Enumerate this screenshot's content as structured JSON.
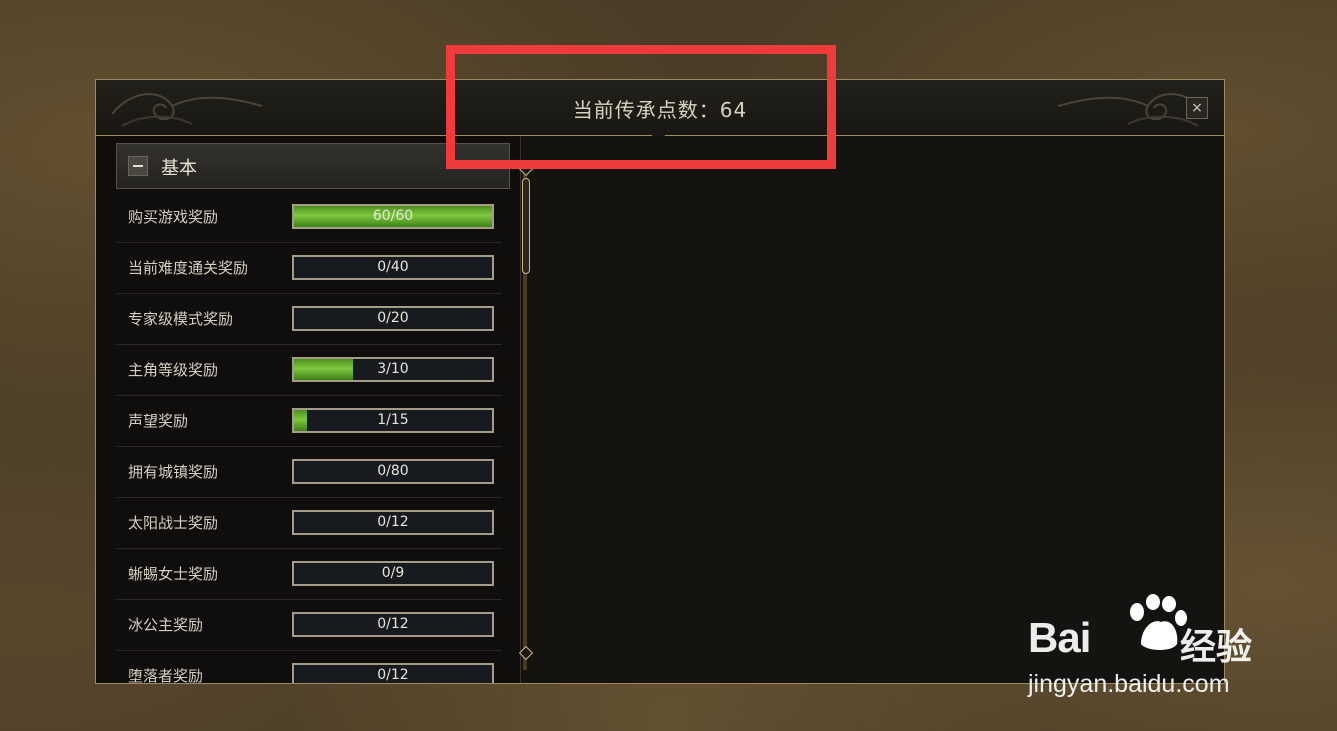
{
  "window": {
    "title": "当前传承点数：64",
    "close_label": "×"
  },
  "section": {
    "title": "基本",
    "rows": [
      {
        "label": "购买游戏奖励",
        "progress": "60/60",
        "fill": 1.0
      },
      {
        "label": "当前难度通关奖励",
        "progress": "0/40",
        "fill": 0.0
      },
      {
        "label": "专家级模式奖励",
        "progress": "0/20",
        "fill": 0.0
      },
      {
        "label": "主角等级奖励",
        "progress": "3/10",
        "fill": 0.3
      },
      {
        "label": "声望奖励",
        "progress": "1/15",
        "fill": 0.067
      },
      {
        "label": "拥有城镇奖励",
        "progress": "0/80",
        "fill": 0.0
      },
      {
        "label": "太阳战士奖励",
        "progress": "0/12",
        "fill": 0.0
      },
      {
        "label": "蜥蜴女士奖励",
        "progress": "0/9",
        "fill": 0.0
      },
      {
        "label": "冰公主奖励",
        "progress": "0/12",
        "fill": 0.0
      },
      {
        "label": "堕落者奖励",
        "progress": "0/12",
        "fill": 0.0
      }
    ]
  },
  "watermark": {
    "brand": "Bai",
    "brand_suffix": "经验",
    "url": "jingyan.baidu.com"
  },
  "colors": {
    "highlight": "#ef3b3b",
    "progress_fill": "#6bb532",
    "frame": "#9c8a63"
  }
}
